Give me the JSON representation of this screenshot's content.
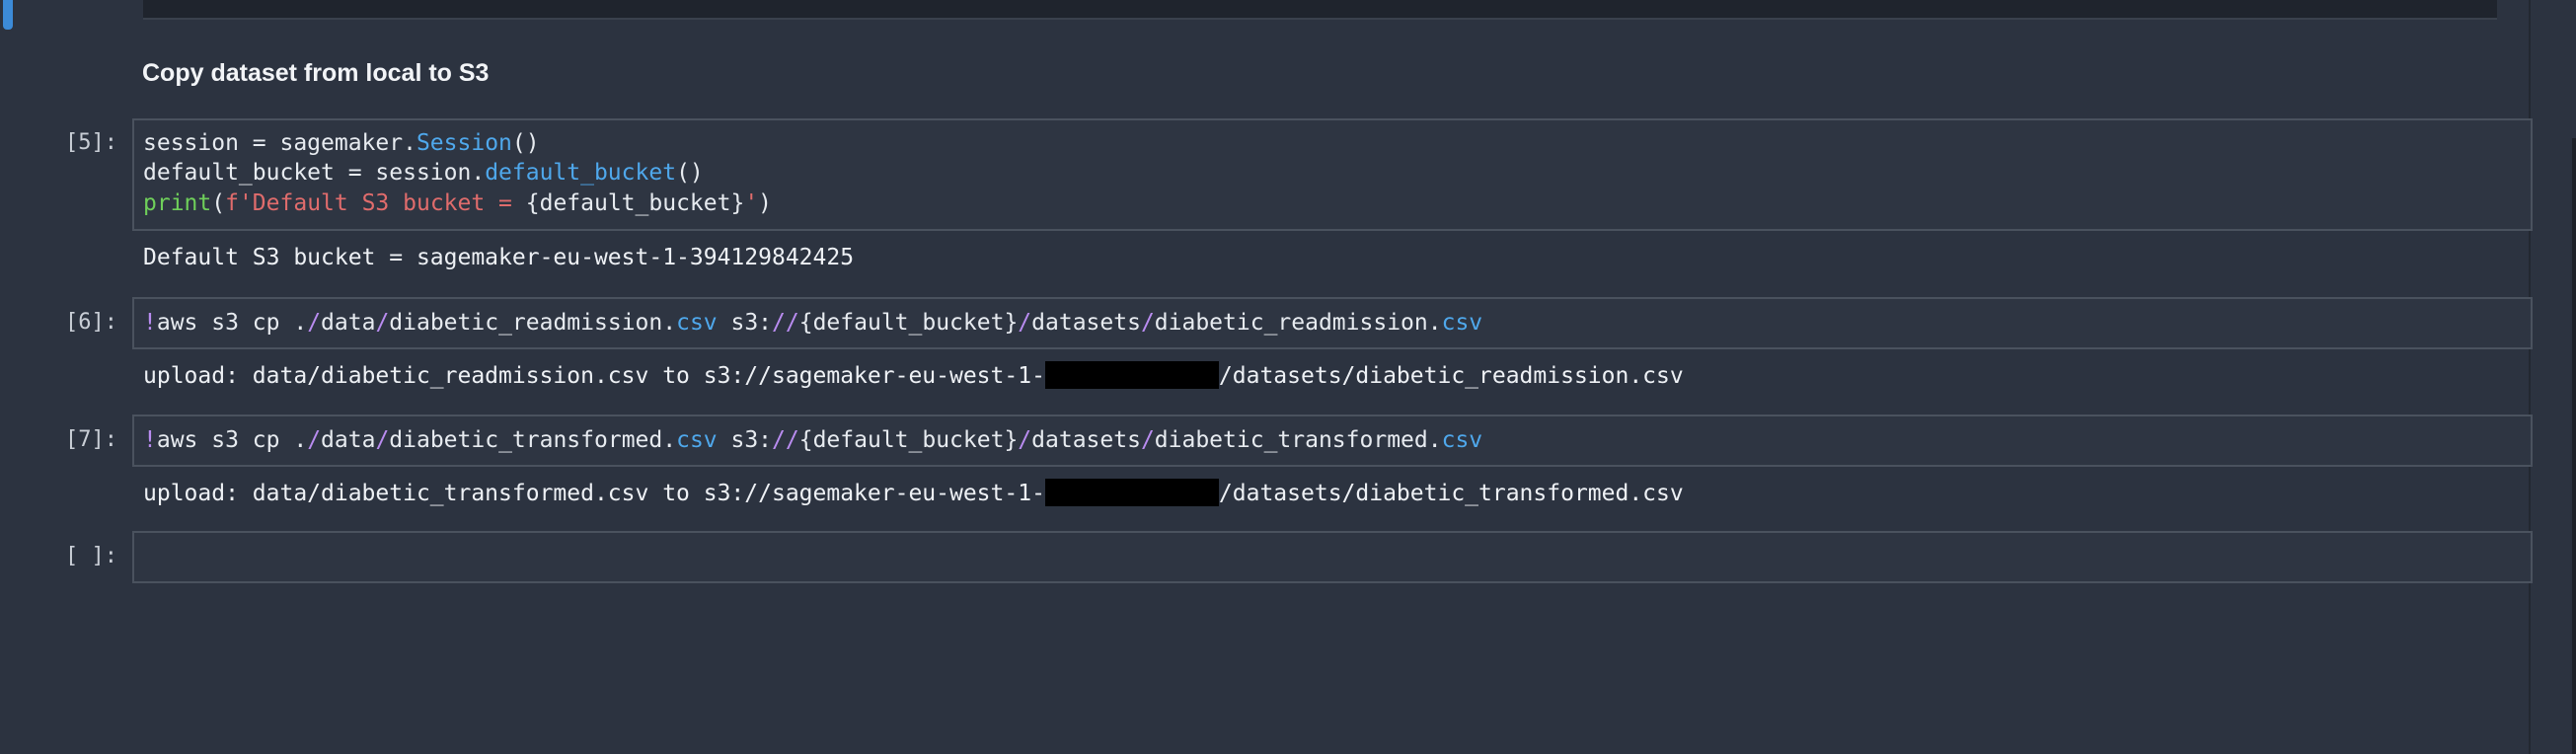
{
  "markdown": {
    "heading": "Copy dataset from local to S3"
  },
  "cells": [
    {
      "prompt": "[5]:",
      "code": [
        [
          {
            "t": "session = sagemaker.",
            "c": "txt"
          },
          {
            "t": "Session",
            "c": "fn"
          },
          {
            "t": "()",
            "c": "txt"
          }
        ],
        [
          {
            "t": "default_bucket = session.",
            "c": "txt"
          },
          {
            "t": "default_bucket",
            "c": "fn"
          },
          {
            "t": "()",
            "c": "txt"
          }
        ],
        [
          {
            "t": "print",
            "c": "bi"
          },
          {
            "t": "(",
            "c": "txt"
          },
          {
            "t": "f'Default S3 bucket = ",
            "c": "str"
          },
          {
            "t": "{default_bucket}",
            "c": "txt"
          },
          {
            "t": "'",
            "c": "str"
          },
          {
            "t": ")",
            "c": "txt"
          }
        ]
      ],
      "output": "Default S3 bucket = sagemaker-eu-west-1-394129842425"
    },
    {
      "prompt": "[6]:",
      "code": [
        [
          {
            "t": "!",
            "c": "kw"
          },
          {
            "t": "aws s3 cp .",
            "c": "txt"
          },
          {
            "t": "/",
            "c": "op"
          },
          {
            "t": "data",
            "c": "txt"
          },
          {
            "t": "/",
            "c": "op"
          },
          {
            "t": "diabetic_readmission.",
            "c": "txt"
          },
          {
            "t": "csv",
            "c": "fn"
          },
          {
            "t": " s3:",
            "c": "txt"
          },
          {
            "t": "//",
            "c": "op"
          },
          {
            "t": "{default_bucket}",
            "c": "txt"
          },
          {
            "t": "/",
            "c": "op"
          },
          {
            "t": "datasets",
            "c": "txt"
          },
          {
            "t": "/",
            "c": "op"
          },
          {
            "t": "diabetic_readmission.",
            "c": "txt"
          },
          {
            "t": "csv",
            "c": "fn"
          }
        ]
      ],
      "output_prefix": "upload: data/diabetic_readmission.csv to s3://sagemaker-eu-west-1-",
      "output_suffix": "/datasets/diabetic_readmission.csv"
    },
    {
      "prompt": "[7]:",
      "code": [
        [
          {
            "t": "!",
            "c": "kw"
          },
          {
            "t": "aws s3 cp .",
            "c": "txt"
          },
          {
            "t": "/",
            "c": "op"
          },
          {
            "t": "data",
            "c": "txt"
          },
          {
            "t": "/",
            "c": "op"
          },
          {
            "t": "diabetic_transformed.",
            "c": "txt"
          },
          {
            "t": "csv",
            "c": "fn"
          },
          {
            "t": " s3:",
            "c": "txt"
          },
          {
            "t": "//",
            "c": "op"
          },
          {
            "t": "{default_bucket}",
            "c": "txt"
          },
          {
            "t": "/",
            "c": "op"
          },
          {
            "t": "datasets",
            "c": "txt"
          },
          {
            "t": "/",
            "c": "op"
          },
          {
            "t": "diabetic_transformed.",
            "c": "txt"
          },
          {
            "t": "csv",
            "c": "fn"
          }
        ]
      ],
      "output_prefix": "upload: data/diabetic_transformed.csv to s3://sagemaker-eu-west-1-",
      "output_suffix": "/datasets/diabetic_transformed.csv"
    },
    {
      "prompt": "[ ]:",
      "code": []
    }
  ]
}
